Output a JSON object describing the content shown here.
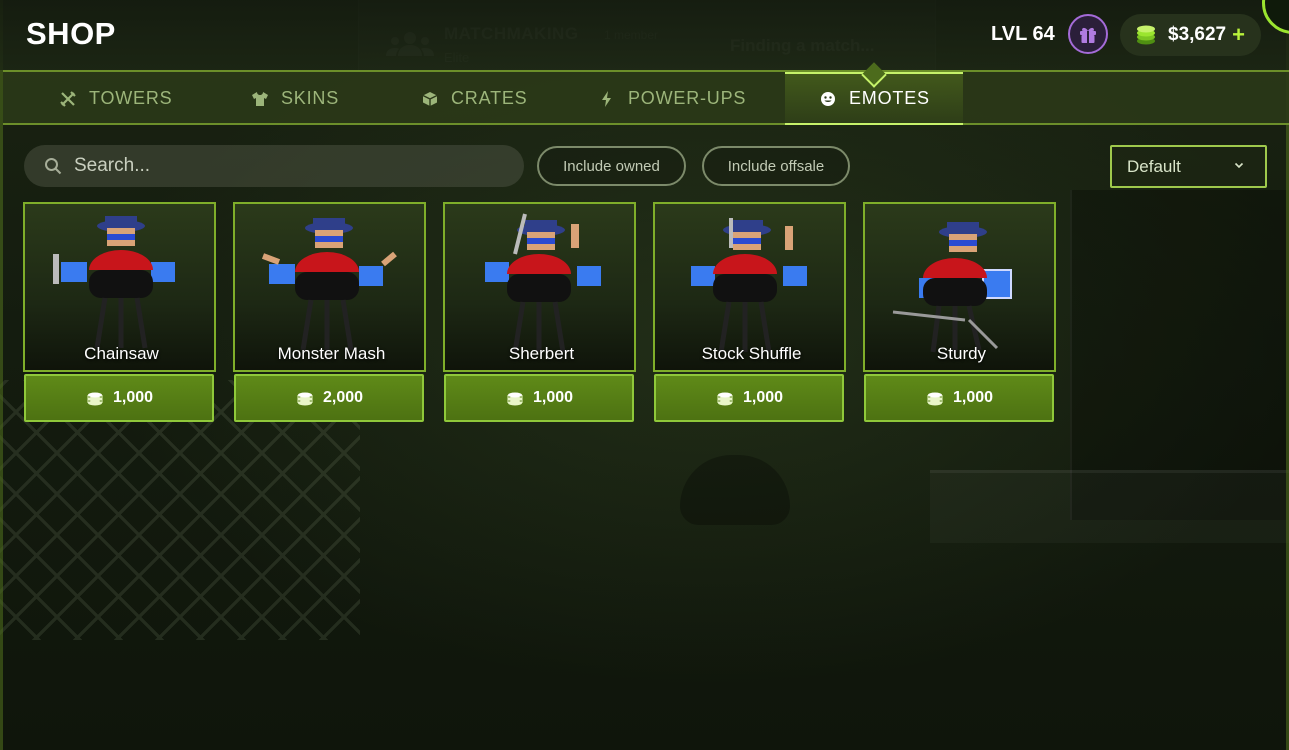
{
  "header": {
    "title": "SHOP",
    "level": "LVL 64",
    "currency": "$3,627",
    "currency_plus": "+"
  },
  "background": {
    "matchmaking_title": "MATCHMAKING",
    "matchmaking_members": "1 member",
    "matchmaking_sub": "Elite",
    "matchmaking_status": "Finding a match..."
  },
  "tabs": [
    {
      "label": "TOWERS",
      "icon": "towers-icon",
      "active": false
    },
    {
      "label": "SKINS",
      "icon": "shirt-icon",
      "active": false
    },
    {
      "label": "CRATES",
      "icon": "crate-icon",
      "active": false
    },
    {
      "label": "POWER-UPS",
      "icon": "lightning-icon",
      "active": false
    },
    {
      "label": "EMOTES",
      "icon": "smiley-icon",
      "active": true
    }
  ],
  "filters": {
    "search_placeholder": "Search...",
    "include_owned": "Include owned",
    "include_offsale": "Include offsale",
    "sort_selected": "Default"
  },
  "items": [
    {
      "name": "Chainsaw",
      "price": "1,000"
    },
    {
      "name": "Monster Mash",
      "price": "2,000"
    },
    {
      "name": "Sherbert",
      "price": "1,000"
    },
    {
      "name": "Stock Shuffle",
      "price": "1,000"
    },
    {
      "name": "Sturdy",
      "price": "1,000"
    }
  ],
  "colors": {
    "accent": "#9be52f",
    "tab_border": "#6c8f2a",
    "price_bg": "#5f8a18",
    "gift_ring": "#a46bd8"
  }
}
